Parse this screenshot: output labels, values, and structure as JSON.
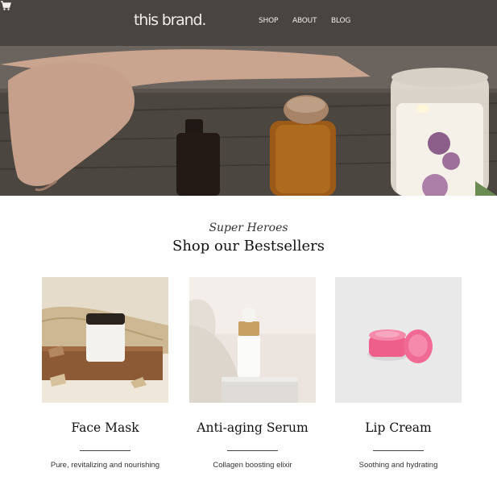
{
  "header": {
    "logo": "this brand.",
    "nav": [
      "SHOP",
      "ABOUT",
      "BLOG"
    ],
    "cart_icon": "cart-icon"
  },
  "section": {
    "kicker": "Super Heroes",
    "title": "Shop our Bestsellers"
  },
  "products": [
    {
      "name": "Face Mask",
      "description": "Pure, revitalizing and nourishing"
    },
    {
      "name": "Anti-aging Serum",
      "description": "Collagen boosting elixir"
    },
    {
      "name": "Lip Cream",
      "description": "Soothing and hydrating"
    }
  ],
  "colors": {
    "nav_overlay": "#3c3836",
    "text_dark": "#111111",
    "lip_pink": "#f06a8c"
  }
}
